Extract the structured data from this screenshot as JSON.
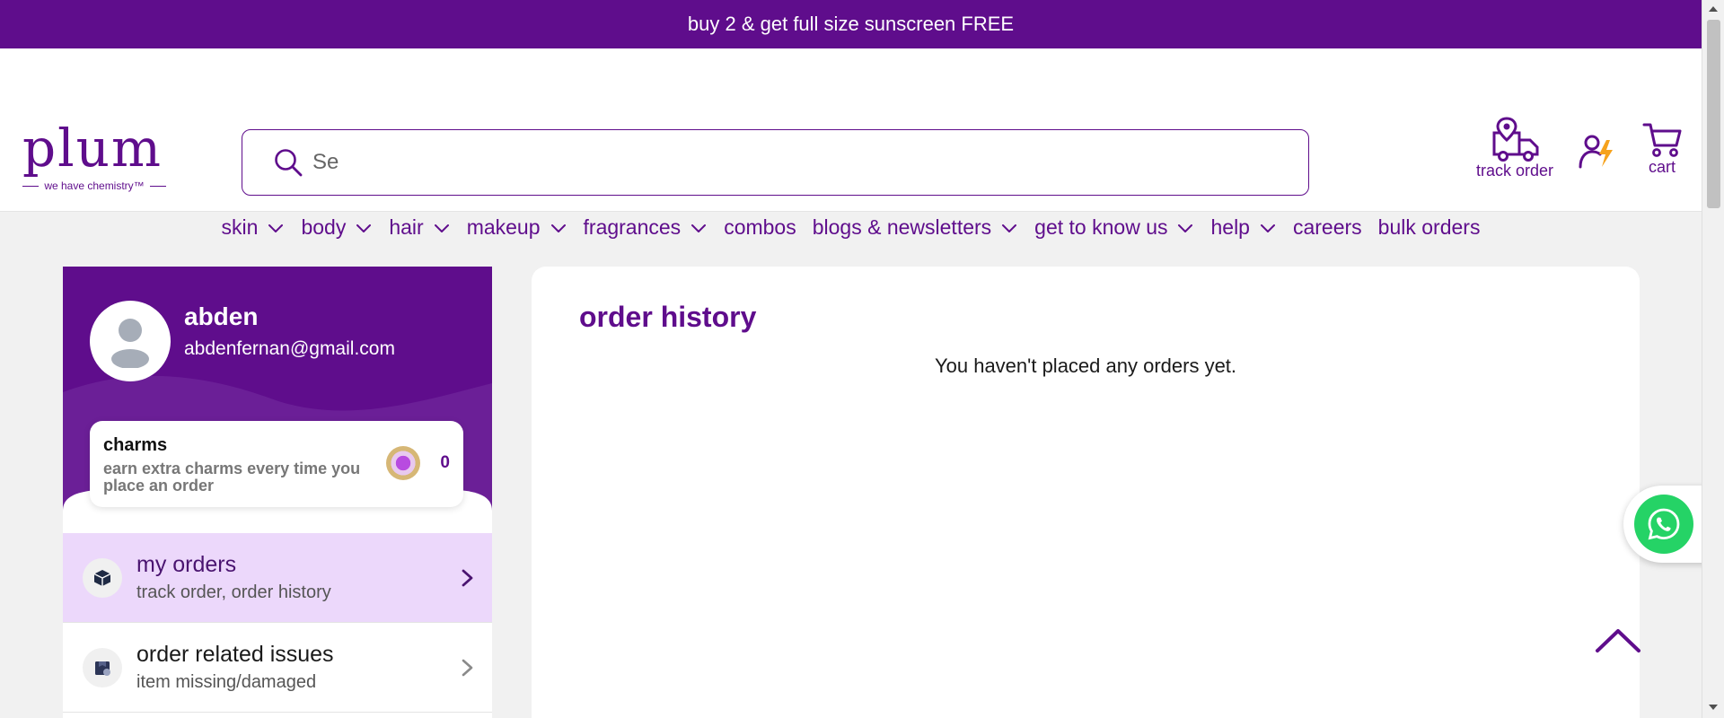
{
  "announcement": "buy 2 & get full size sunscreen FREE",
  "logo": {
    "text": "plum",
    "tagline": "we have chemistry™"
  },
  "search": {
    "value": "",
    "placeholder": "Se"
  },
  "header_actions": {
    "track_order": "track order",
    "cart": "cart"
  },
  "nav": [
    {
      "label": "skin",
      "dropdown": true
    },
    {
      "label": "body",
      "dropdown": true
    },
    {
      "label": "hair",
      "dropdown": true
    },
    {
      "label": "makeup",
      "dropdown": true
    },
    {
      "label": "fragrances",
      "dropdown": true
    },
    {
      "label": "combos",
      "dropdown": false
    },
    {
      "label": "blogs & newsletters",
      "dropdown": true
    },
    {
      "label": "get to know us",
      "dropdown": true
    },
    {
      "label": "help",
      "dropdown": true
    },
    {
      "label": "careers",
      "dropdown": false
    },
    {
      "label": "bulk orders",
      "dropdown": false
    }
  ],
  "profile": {
    "name": "abden",
    "email": "abdenfernan@gmail.com"
  },
  "charms": {
    "title": "charms",
    "subtitle": "earn extra charms every time you place an order",
    "count": "0"
  },
  "menu": [
    {
      "title": "my orders",
      "subtitle": "track order, order history",
      "icon": "box-icon",
      "active": true
    },
    {
      "title": "order related issues",
      "subtitle": "item missing/damaged",
      "icon": "damaged-box-icon",
      "active": false
    }
  ],
  "panel": {
    "title": "order history",
    "empty_message": "You haven't placed any orders yet."
  },
  "colors": {
    "brand": "#5f0d8c",
    "active_bg": "#ecd8fb",
    "whatsapp": "#25d366",
    "page_bg": "#f1f1f1"
  }
}
